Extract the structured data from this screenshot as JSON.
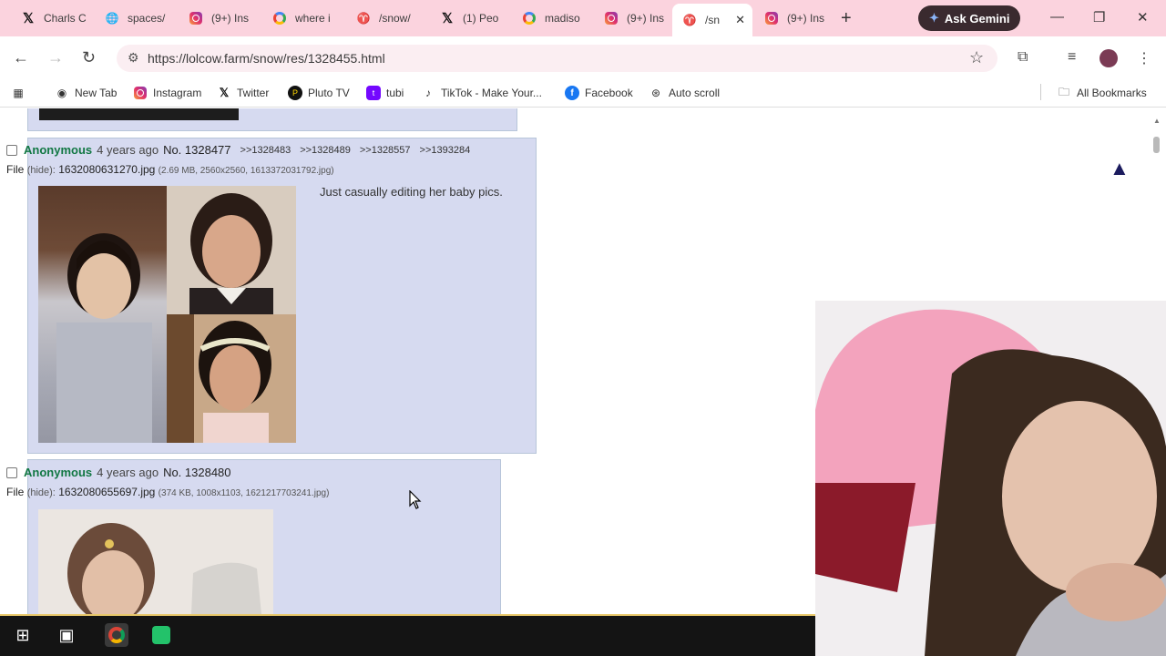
{
  "tabs": [
    {
      "label": "Charls C",
      "icon": "x-logo-icon"
    },
    {
      "label": "spaces/",
      "icon": "globe-icon"
    },
    {
      "label": "(9+) Ins",
      "icon": "instagram-icon"
    },
    {
      "label": "where i",
      "icon": "google-icon"
    },
    {
      "label": "/snow/",
      "icon": "lolcow-icon"
    },
    {
      "label": "(1) Peo",
      "icon": "x-logo-icon"
    },
    {
      "label": "madiso",
      "icon": "google-icon"
    },
    {
      "label": "(9+) Ins",
      "icon": "instagram-icon"
    },
    {
      "label": "/sn",
      "icon": "lolcow-icon"
    },
    {
      "label": "(9+) Ins",
      "icon": "instagram-icon"
    }
  ],
  "gemini_label": "Ask Gemini",
  "url": "https://lolcow.farm/snow/res/1328455.html",
  "bookmarks": [
    {
      "label": "New Tab"
    },
    {
      "label": "Instagram"
    },
    {
      "label": "Twitter"
    },
    {
      "label": "Pluto TV"
    },
    {
      "label": "tubi"
    },
    {
      "label": "TikTok - Make Your..."
    },
    {
      "label": "Facebook"
    },
    {
      "label": "Auto scroll"
    }
  ],
  "all_bookmarks": "All Bookmarks",
  "posts": [
    {
      "name": "Anonymous",
      "time": "4 years ago",
      "no": "No. 1328477",
      "refs": [
        ">>1328483",
        ">>1328489",
        ">>1328557",
        ">>1393284"
      ],
      "file_label": "File",
      "hide_label": "(hide):",
      "filename": "1632080631270.jpg",
      "meta": "(2.69 MB, 2560x2560, 1613372031792.jpg)",
      "text": "Just casually editing her baby pics."
    },
    {
      "name": "Anonymous",
      "time": "4 years ago",
      "no": "No. 1328480",
      "refs": [],
      "file_label": "File",
      "hide_label": "(hide):",
      "filename": "1632080655697.jpg",
      "meta": "(374 KB, 1008x1103, 1621217703241.jpg)",
      "text": ""
    }
  ],
  "go_top": "▲"
}
